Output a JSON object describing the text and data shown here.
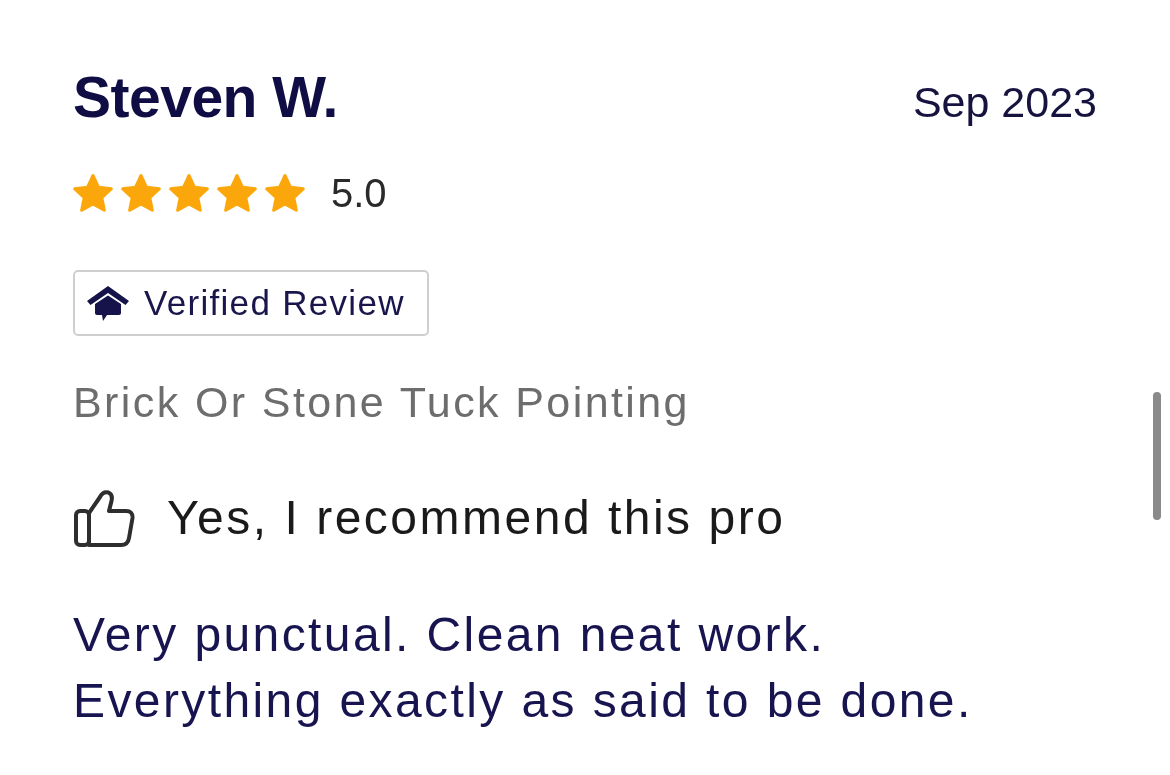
{
  "review": {
    "author": "Steven W.",
    "date": "Sep 2023",
    "stars": 5,
    "rating": "5.0",
    "badge": {
      "label": "Verified Review"
    },
    "service": "Brick Or Stone Tuck Pointing",
    "recommendation": {
      "recommended": true,
      "label": "Yes, I recommend this pro"
    },
    "text": "Very punctual. Clean neat work.\nEverything exactly as said to be done."
  }
}
